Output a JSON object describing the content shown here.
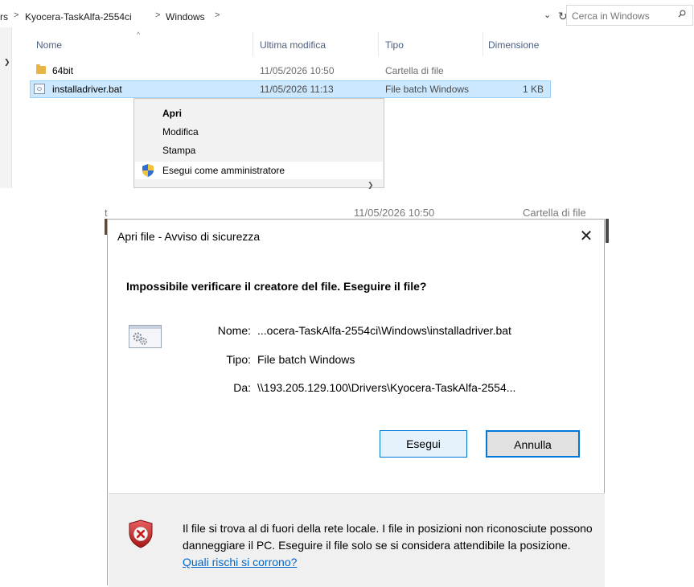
{
  "explorer": {
    "breadcrumb": [
      "rs",
      "Kyocera-TaskAlfa-2554ci",
      "Windows"
    ],
    "breadcrumb_sep": ">",
    "search_placeholder": "Cerca in Windows",
    "columns": [
      "Nome",
      "Ultima modifica",
      "Tipo",
      "Dimensione"
    ],
    "rows": [
      {
        "name": "64bit",
        "modified": "11/05/2026 10:50",
        "type": "Cartella di file",
        "size": "",
        "icon": "folder-icon"
      },
      {
        "name": "installadriver.bat",
        "modified": "11/05/2026 11:13",
        "type": "File batch Windows",
        "size": "1 KB",
        "icon": "batch-file-icon",
        "selected": true
      }
    ]
  },
  "context_menu": {
    "items": [
      "Apri",
      "Modifica",
      "Stampa",
      "Esegui come amministratore"
    ]
  },
  "background_row": {
    "col1": "t",
    "modified": "11/05/2026 10:50",
    "type": "Cartella di file"
  },
  "dialog": {
    "title": "Apri file - Avviso di sicurezza",
    "heading": "Impossibile verificare il creatore del file. Eseguire il file?",
    "name_label": "Nome:",
    "name_value": "...ocera-TaskAlfa-2554ci\\Windows\\installadriver.bat",
    "type_label": "Tipo:",
    "type_value": "File batch Windows",
    "from_label": "Da:",
    "from_value": "\\\\193.205.129.100\\Drivers\\Kyocera-TaskAlfa-2554...",
    "run_button": "Esegui",
    "cancel_button": "Annulla",
    "warning_text": "Il file si trova al di fuori della rete locale. I file in posizioni non riconosciute possono danneggiare il PC. Eseguire il file solo se si considera attendibile la posizione.",
    "warning_link": "Quali rischi si corrono?"
  },
  "colors": {
    "selection": "#cce8ff",
    "accent": "#0078d7",
    "link": "#0066cc"
  }
}
